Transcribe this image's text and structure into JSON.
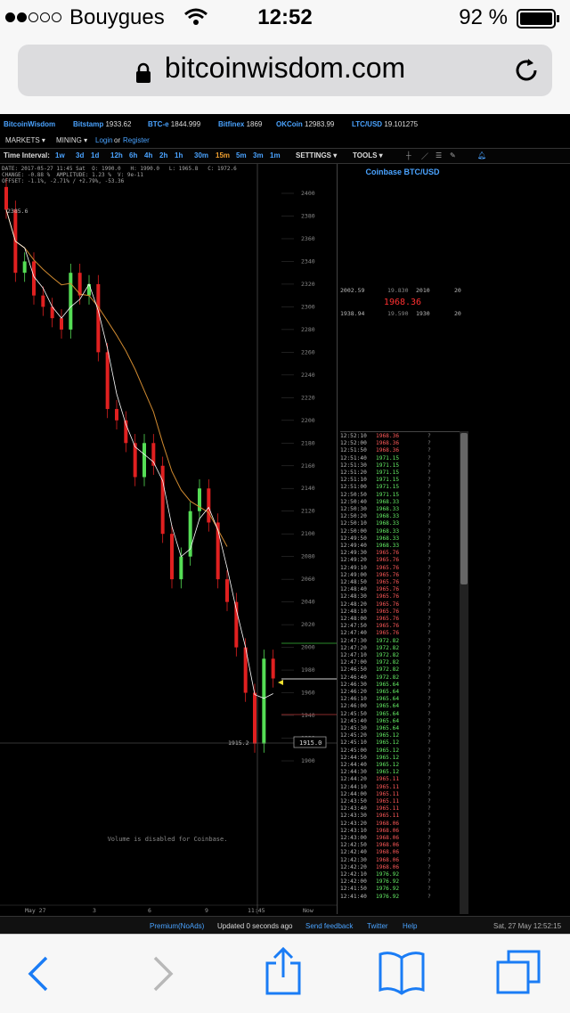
{
  "status_bar": {
    "carrier": "Bouygues",
    "time": "12:52",
    "battery": "92 %"
  },
  "browser": {
    "url": "bitcoinwisdom.com"
  },
  "header": {
    "brand": "BitcoinWisdom",
    "tickers": [
      {
        "name": "Bitstamp",
        "price": "1933.62"
      },
      {
        "name": "BTC-e",
        "price": "1844.999"
      },
      {
        "name": "Bitfinex",
        "price": "1869"
      },
      {
        "name": "OKCoin",
        "price": "12983.99"
      },
      {
        "name": "LTC/USD",
        "price": "19.101275"
      }
    ]
  },
  "menu": {
    "markets": "MARKETS ▾",
    "mining": "MINING ▾",
    "login": "Login",
    "or": "or",
    "register": "Register"
  },
  "toolbar": {
    "label": "Time Interval:",
    "intervals": [
      "1w",
      "3d",
      "1d",
      "12h",
      "6h",
      "4h",
      "2h",
      "1h",
      "30m",
      "15m",
      "5m",
      "3m",
      "1m"
    ],
    "active_interval": "15m",
    "settings": "SETTINGS ▾",
    "tools": "TOOLS ▾"
  },
  "chart_info": {
    "line1": "DATE: 2017-05-27 11:45 Sat  O: 1990.0   H: 1990.0   L: 1965.8   C: 1972.6",
    "line2": "CHANGE: -0.88 %  AMPLITUDE: 1.23 %  V: 9e-11",
    "line3": "OFFSET: -1.1%, -2.71% / +2.79%, -53.36",
    "high_marker": "2385.6",
    "low_marker": "1915.2",
    "current_tag": "1915.0",
    "volume_message": "Volume is disabled for Coinbase.",
    "y_ticks": [
      "2400",
      "2380",
      "2360",
      "2340",
      "2320",
      "2300",
      "2280",
      "2260",
      "2240",
      "2220",
      "2200",
      "2180",
      "2160",
      "2140",
      "2120",
      "2100",
      "2080",
      "2060",
      "2040",
      "2020",
      "2000",
      "1980",
      "1960",
      "1940",
      "1920",
      "1900"
    ],
    "x_ticks": [
      "May 27",
      "3",
      "6",
      "9",
      "11:45",
      "Now"
    ],
    "colors": {
      "up": "#55dd55",
      "down": "#e02020",
      "ma_short": "#ffffff",
      "ma_long": "#d08a30"
    }
  },
  "chart_data": {
    "type": "line",
    "title": "",
    "ylim": [
      1900,
      2400
    ],
    "series": [
      {
        "values": [
          2385.6,
          2330,
          2340,
          2310,
          2300,
          2290,
          2280,
          2330,
          2310,
          2320,
          2260,
          2210,
          2200,
          2180,
          2150,
          2180,
          2160,
          2100,
          2060,
          2080,
          2120,
          2140,
          2110,
          2060,
          2040,
          2000,
          1960,
          1915.2,
          1990,
          1972.6
        ]
      }
    ]
  },
  "right_panel": {
    "title": "Coinbase BTC/USD",
    "orderbook": {
      "ask": [
        "2002.59",
        "19.830",
        "2010",
        "20"
      ],
      "mid": "1968.36",
      "bid": [
        "1938.94",
        "19.590",
        "1930",
        "20"
      ]
    },
    "trades": [
      [
        "12:52:10",
        "1968.36",
        "?",
        "down"
      ],
      [
        "12:52:00",
        "1968.36",
        "?",
        "down"
      ],
      [
        "12:51:50",
        "1968.36",
        "?",
        "down"
      ],
      [
        "12:51:40",
        "1971.15",
        "?",
        "up"
      ],
      [
        "12:51:30",
        "1971.15",
        "?",
        "up"
      ],
      [
        "12:51:20",
        "1971.15",
        "?",
        "up"
      ],
      [
        "12:51:10",
        "1971.15",
        "?",
        "up"
      ],
      [
        "12:51:00",
        "1971.15",
        "?",
        "up"
      ],
      [
        "12:50:50",
        "1971.15",
        "?",
        "up"
      ],
      [
        "12:50:40",
        "1968.33",
        "?",
        "up"
      ],
      [
        "12:50:30",
        "1968.33",
        "?",
        "up"
      ],
      [
        "12:50:20",
        "1968.33",
        "?",
        "up"
      ],
      [
        "12:50:10",
        "1968.33",
        "?",
        "up"
      ],
      [
        "12:50:00",
        "1968.33",
        "?",
        "up"
      ],
      [
        "12:49:50",
        "1968.33",
        "?",
        "up"
      ],
      [
        "12:49:40",
        "1968.33",
        "?",
        "up"
      ],
      [
        "12:49:30",
        "1965.76",
        "?",
        "down"
      ],
      [
        "12:49:20",
        "1965.76",
        "?",
        "down"
      ],
      [
        "12:49:10",
        "1965.76",
        "?",
        "down"
      ],
      [
        "12:49:00",
        "1965.76",
        "?",
        "down"
      ],
      [
        "12:48:50",
        "1965.76",
        "?",
        "down"
      ],
      [
        "12:48:40",
        "1965.76",
        "?",
        "down"
      ],
      [
        "12:48:30",
        "1965.76",
        "?",
        "down"
      ],
      [
        "12:48:20",
        "1965.76",
        "?",
        "down"
      ],
      [
        "12:48:10",
        "1965.76",
        "?",
        "down"
      ],
      [
        "12:48:00",
        "1965.76",
        "?",
        "down"
      ],
      [
        "12:47:50",
        "1965.76",
        "?",
        "down"
      ],
      [
        "12:47:40",
        "1965.76",
        "?",
        "down"
      ],
      [
        "12:47:30",
        "1972.82",
        "?",
        "up"
      ],
      [
        "12:47:20",
        "1972.82",
        "?",
        "up"
      ],
      [
        "12:47:10",
        "1972.82",
        "?",
        "up"
      ],
      [
        "12:47:00",
        "1972.82",
        "?",
        "up"
      ],
      [
        "12:46:50",
        "1972.82",
        "?",
        "up"
      ],
      [
        "12:46:40",
        "1972.82",
        "?",
        "up"
      ],
      [
        "12:46:30",
        "1965.64",
        "?",
        "up"
      ],
      [
        "12:46:20",
        "1965.64",
        "?",
        "up"
      ],
      [
        "12:46:10",
        "1965.64",
        "?",
        "up"
      ],
      [
        "12:46:00",
        "1965.64",
        "?",
        "up"
      ],
      [
        "12:45:50",
        "1965.64",
        "?",
        "up"
      ],
      [
        "12:45:40",
        "1965.64",
        "?",
        "up"
      ],
      [
        "12:45:30",
        "1965.64",
        "?",
        "up"
      ],
      [
        "12:45:20",
        "1965.12",
        "?",
        "up"
      ],
      [
        "12:45:10",
        "1965.12",
        "?",
        "up"
      ],
      [
        "12:45:00",
        "1965.12",
        "?",
        "up"
      ],
      [
        "12:44:50",
        "1965.12",
        "?",
        "up"
      ],
      [
        "12:44:40",
        "1965.12",
        "?",
        "up"
      ],
      [
        "12:44:30",
        "1965.12",
        "?",
        "up"
      ],
      [
        "12:44:20",
        "1965.11",
        "?",
        "down"
      ],
      [
        "12:44:10",
        "1965.11",
        "?",
        "down"
      ],
      [
        "12:44:00",
        "1965.11",
        "?",
        "down"
      ],
      [
        "12:43:50",
        "1965.11",
        "?",
        "down"
      ],
      [
        "12:43:40",
        "1965.11",
        "?",
        "down"
      ],
      [
        "12:43:30",
        "1965.11",
        "?",
        "down"
      ],
      [
        "12:43:20",
        "1968.06",
        "?",
        "down"
      ],
      [
        "12:43:10",
        "1968.06",
        "?",
        "down"
      ],
      [
        "12:43:00",
        "1968.06",
        "?",
        "down"
      ],
      [
        "12:42:50",
        "1968.06",
        "?",
        "down"
      ],
      [
        "12:42:40",
        "1968.06",
        "?",
        "down"
      ],
      [
        "12:42:30",
        "1968.06",
        "?",
        "down"
      ],
      [
        "12:42:20",
        "1968.06",
        "?",
        "down"
      ],
      [
        "12:42:10",
        "1976.92",
        "?",
        "up"
      ],
      [
        "12:42:00",
        "1976.92",
        "?",
        "up"
      ],
      [
        "12:41:50",
        "1976.92",
        "?",
        "up"
      ],
      [
        "12:41:40",
        "1976.92",
        "?",
        "up"
      ]
    ]
  },
  "footer": {
    "premium": "Premium(NoAds)",
    "updated": "Updated 0 seconds ago",
    "feedback": "Send feedback",
    "twitter": "Twitter",
    "help": "Help",
    "datetime": "Sat, 27 May 12:52:15"
  }
}
